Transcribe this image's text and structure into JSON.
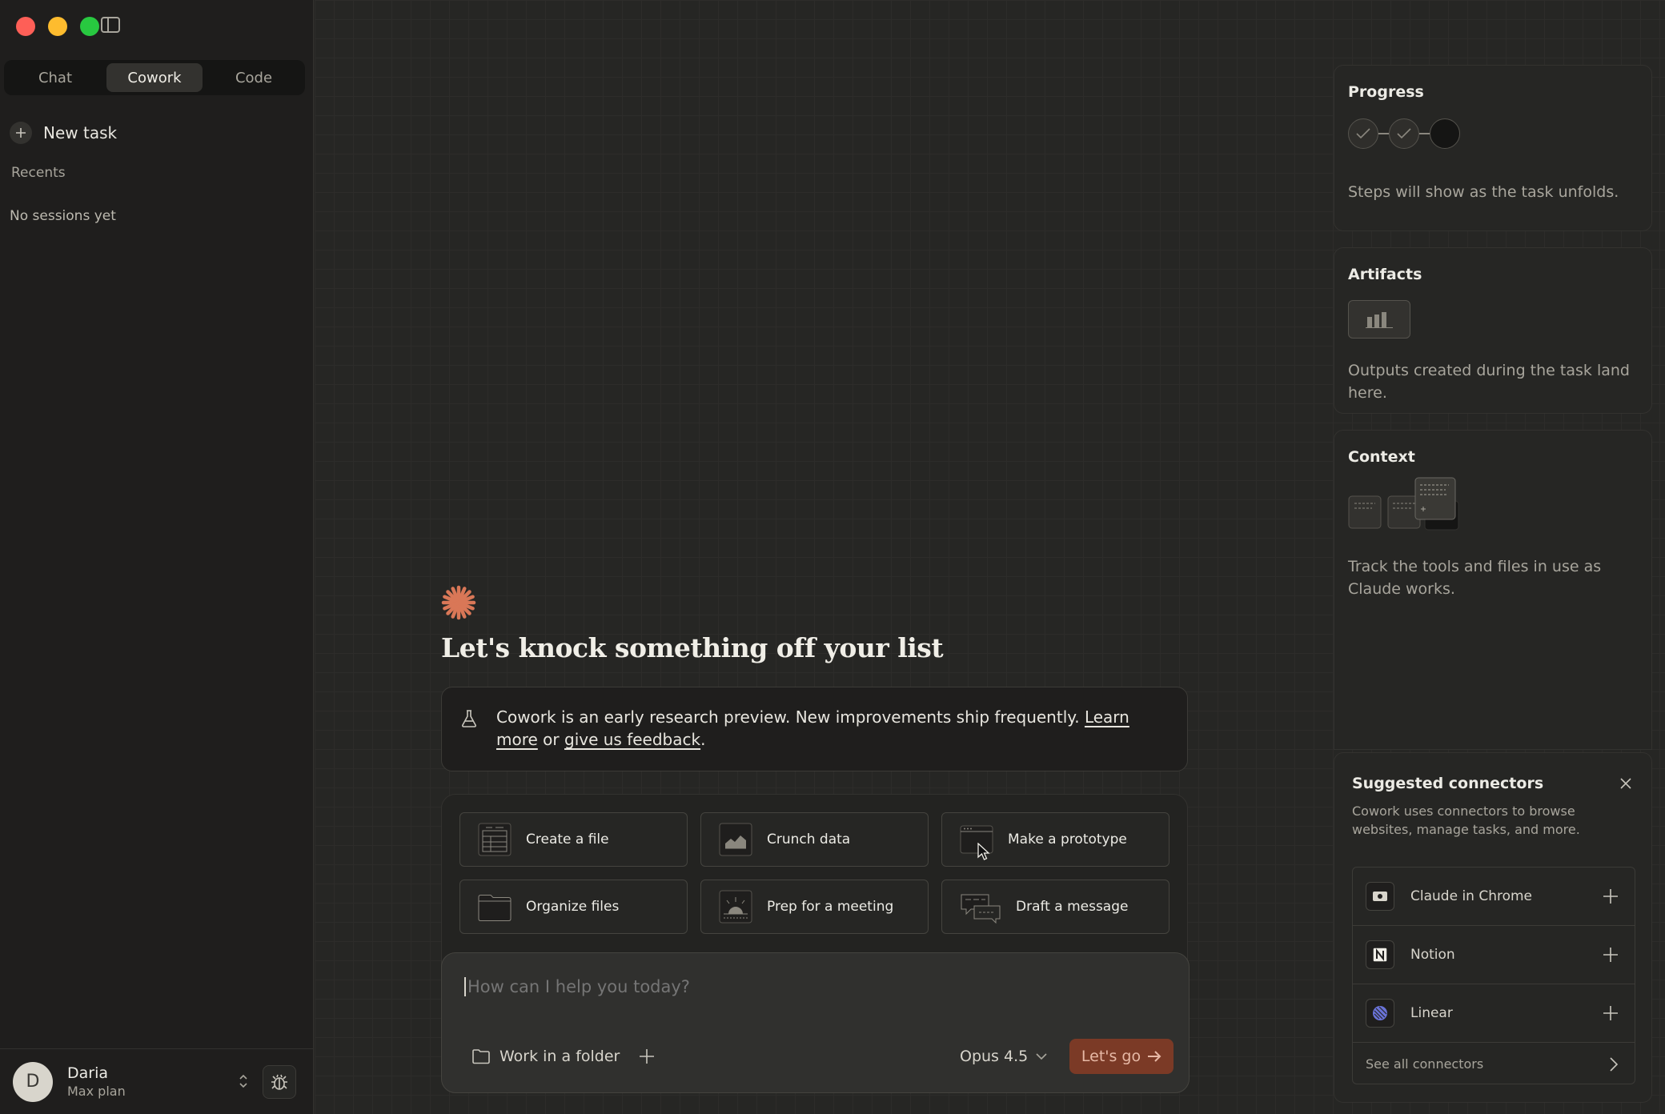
{
  "sidebar": {
    "mode_tabs": [
      {
        "label": "Chat",
        "active": false
      },
      {
        "label": "Cowork",
        "active": true
      },
      {
        "label": "Code",
        "active": false
      }
    ],
    "new_task_label": "New task",
    "recents_label": "Recents",
    "empty_sessions_label": "No sessions yet",
    "user": {
      "initial": "D",
      "name": "Daria",
      "plan": "Max plan"
    }
  },
  "main": {
    "title": "Let's knock something off your list",
    "notice": {
      "text": "Cowork is an early research preview. New improvements ship frequently.",
      "learn_more": "Learn more",
      "or": "or",
      "feedback": "give us feedback",
      "period": "."
    },
    "actions": [
      {
        "label": "Create a file",
        "icon": "document-icon"
      },
      {
        "label": "Crunch data",
        "icon": "chart-icon"
      },
      {
        "label": "Make a prototype",
        "icon": "window-icon"
      },
      {
        "label": "Organize files",
        "icon": "folder-icon"
      },
      {
        "label": "Prep for a meeting",
        "icon": "calendar-icon"
      },
      {
        "label": "Draft a message",
        "icon": "message-icon"
      }
    ],
    "composer": {
      "placeholder": "How can I help you today?",
      "folder_label": "Work in a folder",
      "model": "Opus 4.5",
      "submit_label": "Let's go"
    },
    "accent_color": "#d97757"
  },
  "right_panel": {
    "progress": {
      "title": "Progress",
      "description": "Steps will show as the task unfolds."
    },
    "artifacts": {
      "title": "Artifacts",
      "description": "Outputs created during the task land here."
    },
    "context": {
      "title": "Context",
      "description": "Track the tools and files in use as Claude works."
    },
    "connectors": {
      "title": "Suggested connectors",
      "description": "Cowork uses connectors to browse websites, manage tasks, and more.",
      "items": [
        {
          "name": "Claude in Chrome",
          "icon": "chrome-extension-icon"
        },
        {
          "name": "Notion",
          "icon": "notion-icon"
        },
        {
          "name": "Linear",
          "icon": "linear-icon"
        }
      ],
      "see_all": "See all connectors"
    }
  }
}
